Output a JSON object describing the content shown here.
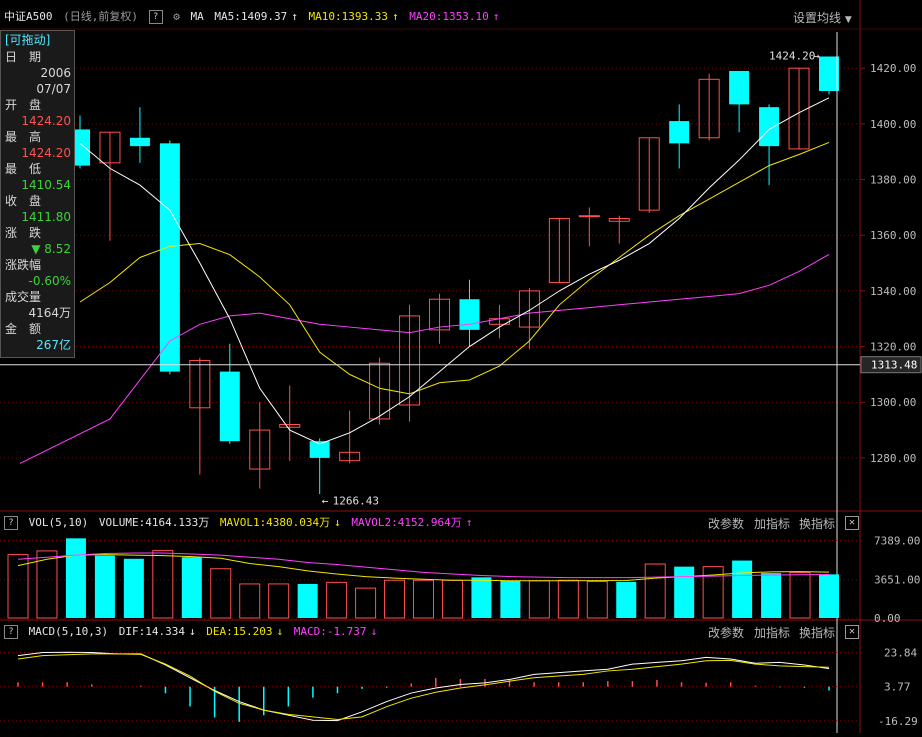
{
  "header_main": {
    "name": "中证A500",
    "period": "(日线,前复权)",
    "ma_label": "MA",
    "ma5": "MA5:1409.37",
    "ma10": "MA10:1393.33",
    "ma20": "MA20:1353.10",
    "settings": "设置均线",
    "help": "?"
  },
  "header_vol": {
    "indicator": "VOL(5,10)",
    "volume": "VOLUME:4164.133万",
    "mavol1": "MAVOL1:4380.034万",
    "mavol2": "MAVOL2:4152.964万",
    "modify": "改参数",
    "add": "加指标",
    "switch": "换指标",
    "help": "?"
  },
  "header_macd": {
    "indicator": "MACD(5,10,3)",
    "dif": "DIF:14.334",
    "dea": "DEA:15.203",
    "macd": "MACD:-1.737",
    "modify": "改参数",
    "add": "加指标",
    "switch": "换指标",
    "help": "?"
  },
  "infobox": {
    "title": "[可拖动]",
    "date_label": "日　期",
    "date_year": "2006",
    "date_md": "07/07",
    "open_label": "开　盘",
    "open": "1424.20",
    "high_label": "最　高",
    "high": "1424.20",
    "low_label": "最　低",
    "low": "1410.54",
    "close_label": "收　盘",
    "close": "1411.80",
    "change_label": "涨　跌",
    "change": "▼ 8.52",
    "pct_label": "涨跌幅",
    "pct": "-0.60%",
    "vol_label": "成交量",
    "vol": "4164万",
    "amt_label": "金　额",
    "amt": "267亿"
  },
  "annotations": {
    "high": "1424.20",
    "low": "1266.43",
    "crosshair_price": "1313.48"
  },
  "colors": {
    "up": "#ff5050",
    "down": "#00ffff",
    "ma5": "#ffffff",
    "ma10": "#f2e600",
    "ma20": "#ff40ff",
    "grid": "#7a0000",
    "bg": "#000000"
  },
  "chart_data": [
    {
      "type": "candlestick",
      "y_ticks": [
        "1420.00",
        "1400.00",
        "1380.00",
        "1360.00",
        "1340.00",
        "1320.00",
        "1300.00",
        "1280.00"
      ],
      "ylim": [
        1262,
        1433
      ],
      "candles": [
        {
          "o": 1398,
          "h": 1403,
          "l": 1384,
          "c": 1385
        },
        {
          "o": 1386,
          "h": 1397,
          "l": 1358,
          "c": 1397
        },
        {
          "o": 1395,
          "h": 1406,
          "l": 1386,
          "c": 1392
        },
        {
          "o": 1393,
          "h": 1394,
          "l": 1310,
          "c": 1311
        },
        {
          "o": 1298,
          "h": 1316,
          "l": 1274,
          "c": 1315
        },
        {
          "o": 1311,
          "h": 1321,
          "l": 1285,
          "c": 1286
        },
        {
          "o": 1276,
          "h": 1300,
          "l": 1269,
          "c": 1290
        },
        {
          "o": 1291,
          "h": 1306,
          "l": 1279,
          "c": 1292
        },
        {
          "o": 1286,
          "h": 1287,
          "l": 1267,
          "c": 1280
        },
        {
          "o": 1279,
          "h": 1297,
          "l": 1278,
          "c": 1282
        },
        {
          "o": 1294,
          "h": 1316,
          "l": 1292,
          "c": 1314
        },
        {
          "o": 1299,
          "h": 1335,
          "l": 1293,
          "c": 1331
        },
        {
          "o": 1326,
          "h": 1339,
          "l": 1321,
          "c": 1337
        },
        {
          "o": 1337,
          "h": 1344,
          "l": 1320,
          "c": 1326
        },
        {
          "o": 1328,
          "h": 1335,
          "l": 1323,
          "c": 1330
        },
        {
          "o": 1327,
          "h": 1341,
          "l": 1319,
          "c": 1340
        },
        {
          "o": 1343,
          "h": 1366,
          "l": 1343,
          "c": 1366
        },
        {
          "o": 1367,
          "h": 1370,
          "l": 1356,
          "c": 1367
        },
        {
          "o": 1365,
          "h": 1367,
          "l": 1357,
          "c": 1366
        },
        {
          "o": 1369,
          "h": 1395,
          "l": 1368,
          "c": 1395
        },
        {
          "o": 1401,
          "h": 1407,
          "l": 1384,
          "c": 1393
        },
        {
          "o": 1395,
          "h": 1418,
          "l": 1394,
          "c": 1416
        },
        {
          "o": 1419,
          "h": 1419,
          "l": 1397,
          "c": 1407
        },
        {
          "o": 1406,
          "h": 1407,
          "l": 1378,
          "c": 1392
        },
        {
          "o": 1391,
          "h": 1420,
          "l": 1391,
          "c": 1420
        },
        {
          "o": 1424.2,
          "h": 1424.2,
          "l": 1410.54,
          "c": 1411.8
        }
      ],
      "ma5": [
        1393,
        1384,
        1378,
        1369,
        1350,
        1330,
        1305,
        1290,
        1285,
        1289,
        1295,
        1302,
        1311,
        1320,
        1327,
        1333,
        1340,
        1346,
        1351,
        1357,
        1366,
        1377,
        1387,
        1398,
        1404,
        1409.37
      ],
      "ma10": [
        1336,
        1343,
        1352,
        1356,
        1357,
        1353,
        1345,
        1335,
        1318,
        1310,
        1305,
        1303,
        1307,
        1308,
        1313,
        1322,
        1335,
        1344,
        1352,
        1360,
        1367,
        1373,
        1379,
        1385,
        1389,
        1393.33
      ],
      "ma20": [
        1278,
        1294,
        1308,
        1322,
        1328,
        1331,
        1332,
        1330,
        1328,
        1327,
        1326,
        1325,
        1327,
        1328,
        1330,
        1332,
        1333,
        1334,
        1335,
        1336,
        1337,
        1338,
        1339,
        1342,
        1347,
        1353.1
      ]
    },
    {
      "type": "bar",
      "y_ticks": [
        "7389.00",
        "3651.00",
        "0.00"
      ],
      "ylim": [
        0,
        8300
      ],
      "values": [
        6050,
        6400,
        7600,
        5950,
        5650,
        6450,
        5800,
        4700,
        3250,
        3250,
        3250,
        3400,
        2850,
        3600,
        3600,
        3600,
        3880,
        3550,
        3550,
        3600,
        3480,
        3450,
        5150,
        4900,
        4900,
        5480,
        4280,
        4350,
        4164
      ]
    },
    {
      "type": "line",
      "y_ticks": [
        "23.84",
        "3.77",
        "-16.29"
      ],
      "ylim": [
        -17,
        30
      ],
      "dif": [
        22,
        23.8,
        24,
        23.8,
        23,
        23,
        16.5,
        9,
        1.5,
        -5,
        -10,
        -13,
        -16,
        -16.2,
        -11,
        -5,
        0,
        3,
        5,
        6,
        8,
        11,
        12,
        13,
        14,
        17,
        18,
        19,
        21,
        20,
        17.5,
        18,
        16.5,
        14.33
      ],
      "dea": [
        20,
        22,
        22.5,
        23,
        23,
        22.7,
        17,
        10,
        1,
        -6,
        -10,
        -12.5,
        -14,
        -15.5,
        -14,
        -8,
        -3,
        0.5,
        3,
        4.8,
        7,
        9,
        10,
        11,
        13,
        14,
        15.5,
        17,
        19,
        19.2,
        17,
        16,
        15.5,
        15.2
      ],
      "macd": [
        2,
        2,
        2,
        1,
        0,
        0.5,
        -3,
        -9,
        -14,
        -16,
        -13,
        -9,
        -5,
        -3,
        -1,
        -0.5,
        1.5,
        4,
        3.5,
        3.5,
        3,
        2,
        2,
        2,
        2.5,
        2.5,
        3,
        2,
        1.8,
        2,
        0.5,
        -0.3,
        -0.5,
        -1.737
      ]
    }
  ]
}
